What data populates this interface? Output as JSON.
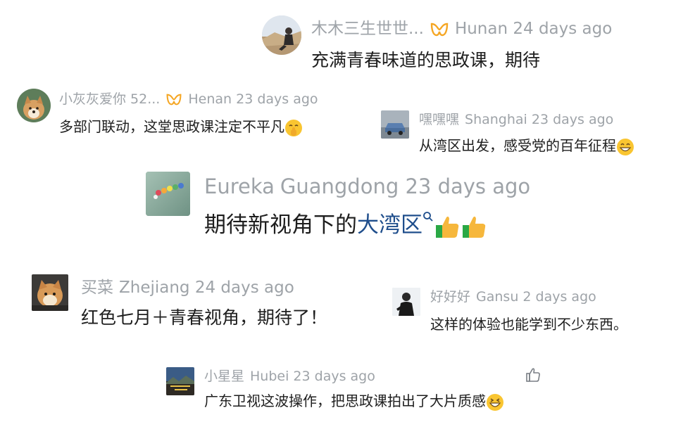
{
  "colors": {
    "meta_text": "#9ea3a8",
    "body_text": "#1e1e1e",
    "link_text": "#1f4e8c",
    "vip_badge": "#f5a623",
    "thumb_emoji": "#f6b73c",
    "thumb_cuff": "#2aa845"
  },
  "comments": [
    {
      "user": "木木三生世世...",
      "location": "Hunan",
      "time": "24 days ago",
      "text": "充满青春味道的思政课，期待",
      "vip": true
    },
    {
      "user": "小灰灰爱你 52...",
      "location": "Henan",
      "time": "23 days ago",
      "text": "多部门联动，这堂思政课注定不平凡",
      "vip": true,
      "emoji": "shushing-face-emoji"
    },
    {
      "user": "嘿嘿嘿",
      "location": "Shanghai",
      "time": "23 days ago",
      "text": "从湾区出发，感受党的百年征程",
      "emoji": "grinning-face-emoji"
    },
    {
      "user": "Eureka",
      "location": "Guangdong",
      "time": "23 days ago",
      "text": "期待新视角下的",
      "link": "大湾区",
      "emoji": "thumbs-up-emoji"
    },
    {
      "user": "买菜",
      "location": "Zhejiang",
      "time": "24 days ago",
      "text": "红色七月＋青春视角，期待了！"
    },
    {
      "user": "好好好",
      "location": "Gansu",
      "time": "2 days ago",
      "text": "这样的体验也能学到不少东西。"
    },
    {
      "user": "小星星",
      "location": "Hubei",
      "time": "23 days ago",
      "text": "广东卫视这波操作，把思政课拍出了大片质感",
      "emoji": "grinning-squint-face-emoji",
      "like_icon": "thumbs-up-outline-icon"
    }
  ]
}
